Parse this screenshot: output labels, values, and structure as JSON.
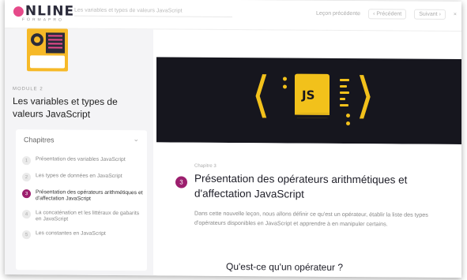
{
  "header": {
    "logo": "NLINE",
    "logo_sub": "FORMAPRO",
    "course_title": "Les variables et types de valeurs JavaScript",
    "actions": [
      "Leçon précédente",
      "Précédent",
      "Suivant",
      "×"
    ]
  },
  "sidebar": {
    "module_label": "MODULE 2",
    "module_title": "Les variables et types de valeurs JavaScript",
    "chapters_heading": "Chapitres",
    "chapters": [
      {
        "num": "1",
        "label": "Présentation des variables JavaScript"
      },
      {
        "num": "2",
        "label": "Les types de données en JavaScript"
      },
      {
        "num": "3",
        "label": "Présentation des opérateurs arithmétiques et d'affectation JavaScript",
        "active": true
      },
      {
        "num": "4",
        "label": "La concaténation et les littéraux de gabarits en JavaScript"
      },
      {
        "num": "5",
        "label": "Les constantes en JavaScript"
      }
    ]
  },
  "main": {
    "hero_label": "JS",
    "chapter_label": "Chapitre 3",
    "chapter_number": "3",
    "title": "Présentation des opérateurs arithmétiques et d'affectation JavaScript",
    "description": "Dans cette nouvelle leçon, nous allons définir ce qu'est un opérateur, établir la liste des types d'opérateurs disponibles en JavaScript et apprendre à en manipuler certains.",
    "section_heading": "Qu'est-ce qu'un opérateur ?"
  },
  "colors": {
    "accent": "#9c1f6e",
    "hero_bg": "#16161e",
    "hero_yellow": "#f2c11b"
  }
}
